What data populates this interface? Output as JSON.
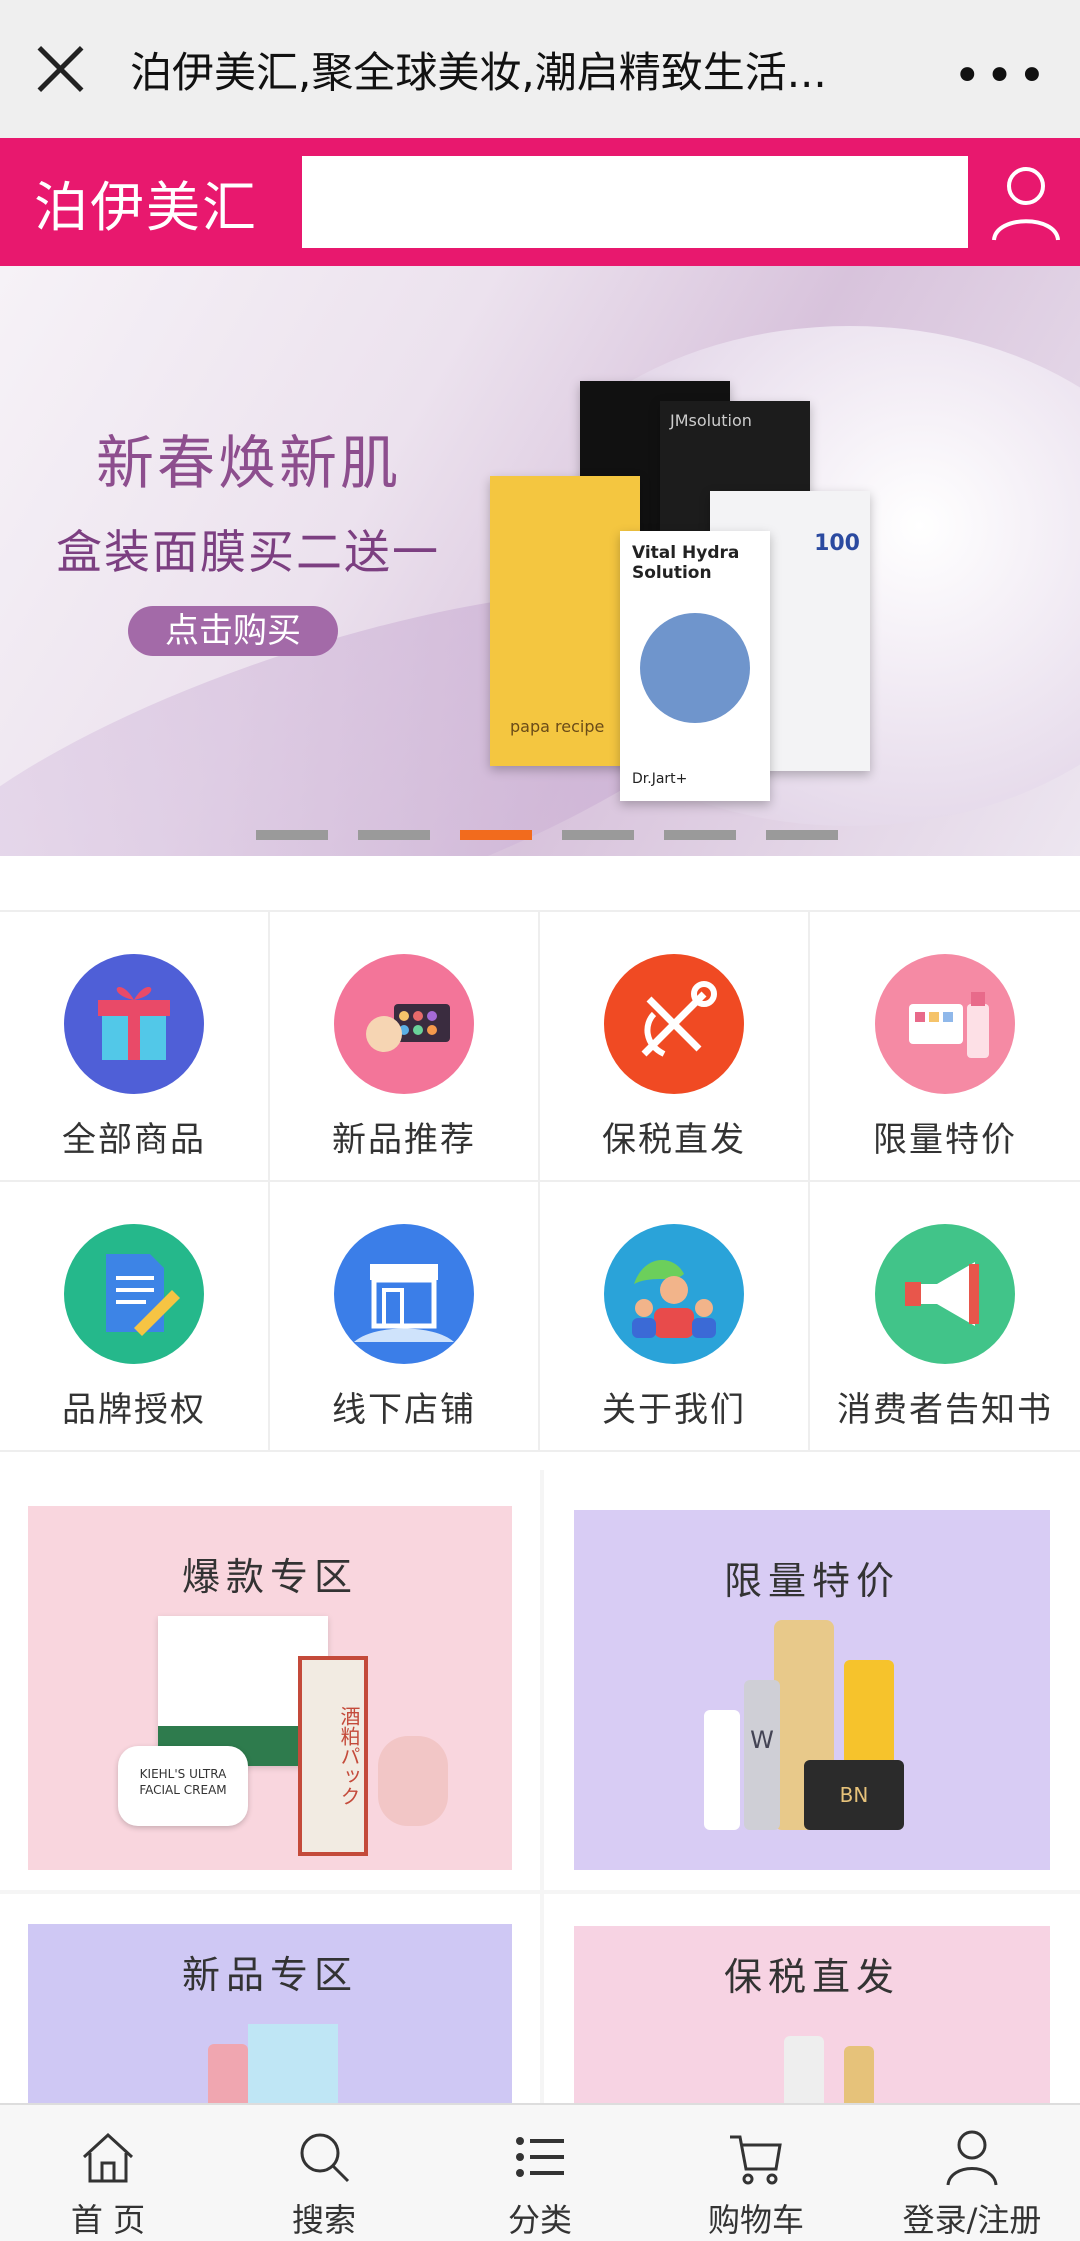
{
  "topbar": {
    "title": "泊伊美汇,聚全球美妆,潮启精致生活...",
    "more": "•••"
  },
  "header": {
    "brand": "泊伊美汇",
    "search_placeholder": ""
  },
  "banner": {
    "headline": "新春焕新肌",
    "subhead": "盒装面膜买二送一",
    "cta": "点击购买",
    "mask_texts": [
      "JMsolution",
      "Vital Hydra Solution",
      "Dr.Jart+",
      "papa recipe",
      "100"
    ],
    "slide_count": 6,
    "active_slide": 3
  },
  "grid": [
    {
      "label": "全部商品",
      "icon": "gift-icon",
      "color": "#4f5fd7"
    },
    {
      "label": "新品推荐",
      "icon": "makeup-palette-icon",
      "color": "#f37599"
    },
    {
      "label": "保税直发",
      "icon": "anchor-icon",
      "color": "#f04a23"
    },
    {
      "label": "限量特价",
      "icon": "cosmetics-icon",
      "color": "#f58aa4"
    },
    {
      "label": "品牌授权",
      "icon": "document-pencil-icon",
      "color": "#25b88b"
    },
    {
      "label": "线下店铺",
      "icon": "storefront-icon",
      "color": "#3b7ee8"
    },
    {
      "label": "关于我们",
      "icon": "team-globe-icon",
      "color": "#2aa3d9"
    },
    {
      "label": "消费者告知书",
      "icon": "megaphone-icon",
      "color": "#41c489"
    }
  ],
  "promos": [
    {
      "title": "爆款专区",
      "bg": "#f9d6de"
    },
    {
      "title": "限量特价",
      "bg": "#d8ccf4"
    },
    {
      "title": "新品专区",
      "bg": "#cfc8f4"
    },
    {
      "title": "保税直发",
      "bg": "#f7d3e3"
    }
  ],
  "promo_product_texts": {
    "hot": [
      "KIEHL'S ULTRA FACIAL CREAM",
      "酒粕パック"
    ],
    "limited": [
      "W",
      "BN"
    ]
  },
  "bottomnav": [
    {
      "label": "首 页",
      "icon": "home-icon"
    },
    {
      "label": "搜索",
      "icon": "search-icon"
    },
    {
      "label": "分类",
      "icon": "list-icon"
    },
    {
      "label": "购物车",
      "icon": "cart-icon"
    },
    {
      "label": "登录/注册",
      "icon": "user-icon"
    }
  ]
}
